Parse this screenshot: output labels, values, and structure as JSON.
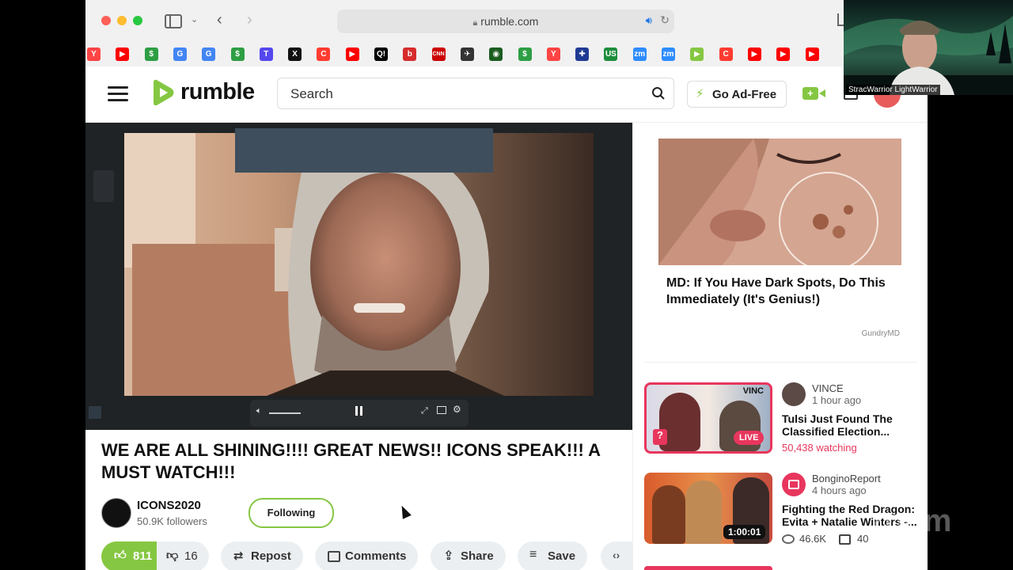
{
  "browser": {
    "url": "rumble.com"
  },
  "bookmarks": [
    {
      "icon": "yandex-icon",
      "glyph": "Y",
      "color": "#ff4444"
    },
    {
      "icon": "youtube-icon",
      "glyph": "▶",
      "color": "#ff0000"
    },
    {
      "icon": "dollar-s-icon",
      "glyph": "$",
      "color": "#2e9e44"
    },
    {
      "icon": "google-icon",
      "glyph": "G",
      "color": "#4285f4"
    },
    {
      "icon": "google-icon",
      "glyph": "G",
      "color": "#4285f4"
    },
    {
      "icon": "dollar-s-icon",
      "glyph": "$",
      "color": "#2e9e44"
    },
    {
      "icon": "truth-social-icon",
      "glyph": "T",
      "color": "#5448ee"
    },
    {
      "icon": "x-icon",
      "glyph": "X",
      "color": "#111111"
    },
    {
      "icon": "refresh-icon",
      "glyph": "C",
      "color": "#ff3b30"
    },
    {
      "icon": "youtube-icon",
      "glyph": "▶",
      "color": "#ff0000"
    },
    {
      "icon": "q-icon",
      "glyph": "Q!",
      "color": "#000000"
    },
    {
      "icon": "b-icon",
      "glyph": "b",
      "color": "#d62c2c"
    },
    {
      "icon": "cnn-icon",
      "glyph": "CNN",
      "color": "#cc0000"
    },
    {
      "icon": "jet-icon",
      "glyph": "✈",
      "color": "#333333"
    },
    {
      "icon": "globe-icon",
      "glyph": "◉",
      "color": "#1b5e20"
    },
    {
      "icon": "dollar-s-icon",
      "glyph": "$",
      "color": "#2e9e44"
    },
    {
      "icon": "yandex-icon",
      "glyph": "Y",
      "color": "#ff4444"
    },
    {
      "icon": "uk-flag-icon",
      "glyph": "✚",
      "color": "#1f3a93"
    },
    {
      "icon": "us-icon",
      "glyph": "US",
      "color": "#1e8e3e"
    },
    {
      "icon": "zm-icon",
      "glyph": "zm",
      "color": "#2d8cff"
    },
    {
      "icon": "zm-icon",
      "glyph": "zm",
      "color": "#2d8cff"
    },
    {
      "icon": "rumble-icon",
      "glyph": "▶",
      "color": "#85c742"
    },
    {
      "icon": "refresh-icon",
      "glyph": "C",
      "color": "#ff3b30"
    },
    {
      "icon": "youtube-icon",
      "glyph": "▶",
      "color": "#ff0000"
    },
    {
      "icon": "youtube-icon",
      "glyph": "▶",
      "color": "#ff0000"
    },
    {
      "icon": "youtube-icon",
      "glyph": "▶",
      "color": "#ff0000"
    }
  ],
  "header": {
    "logo_text": "rumble",
    "search_placeholder": "Search",
    "ad_free_label": "Go Ad-Free"
  },
  "video": {
    "title": "WE ARE ALL SHINING!!!! GREAT NEWS!! ICONS SPEAK!!! A MUST WATCH!!!",
    "channel": "ICONS2020",
    "followers": "50.9K followers",
    "follow_label": "Following",
    "likes": "811",
    "dislikes": "16",
    "actions": {
      "repost": "Repost",
      "comments": "Comments",
      "share": "Share",
      "save": "Save"
    }
  },
  "ad": {
    "headline": "MD: If You Have Dark Spots, Do This Immediately (It's Genius!)",
    "sponsor": "GundryMD"
  },
  "recommended": [
    {
      "channel": "VINCE",
      "time": "1 hour ago",
      "title": "Tulsi Just Found The Classified Election...",
      "badge": "LIVE",
      "thumb_label": "VINC",
      "stat": "50,438 watching"
    },
    {
      "channel": "BonginoReport",
      "time": "4 hours ago",
      "title": "Fighting the Red Dragon: Evita + Natalie Winters -...",
      "badge": "1:00:01",
      "views": "46.6K",
      "comments": "40"
    }
  ],
  "webcam": {
    "name": "StracWarrior LightWarrior"
  },
  "colors": {
    "rumble_green": "#85c742",
    "live_red": "#e8365d",
    "watching_red": "#e8365d"
  }
}
